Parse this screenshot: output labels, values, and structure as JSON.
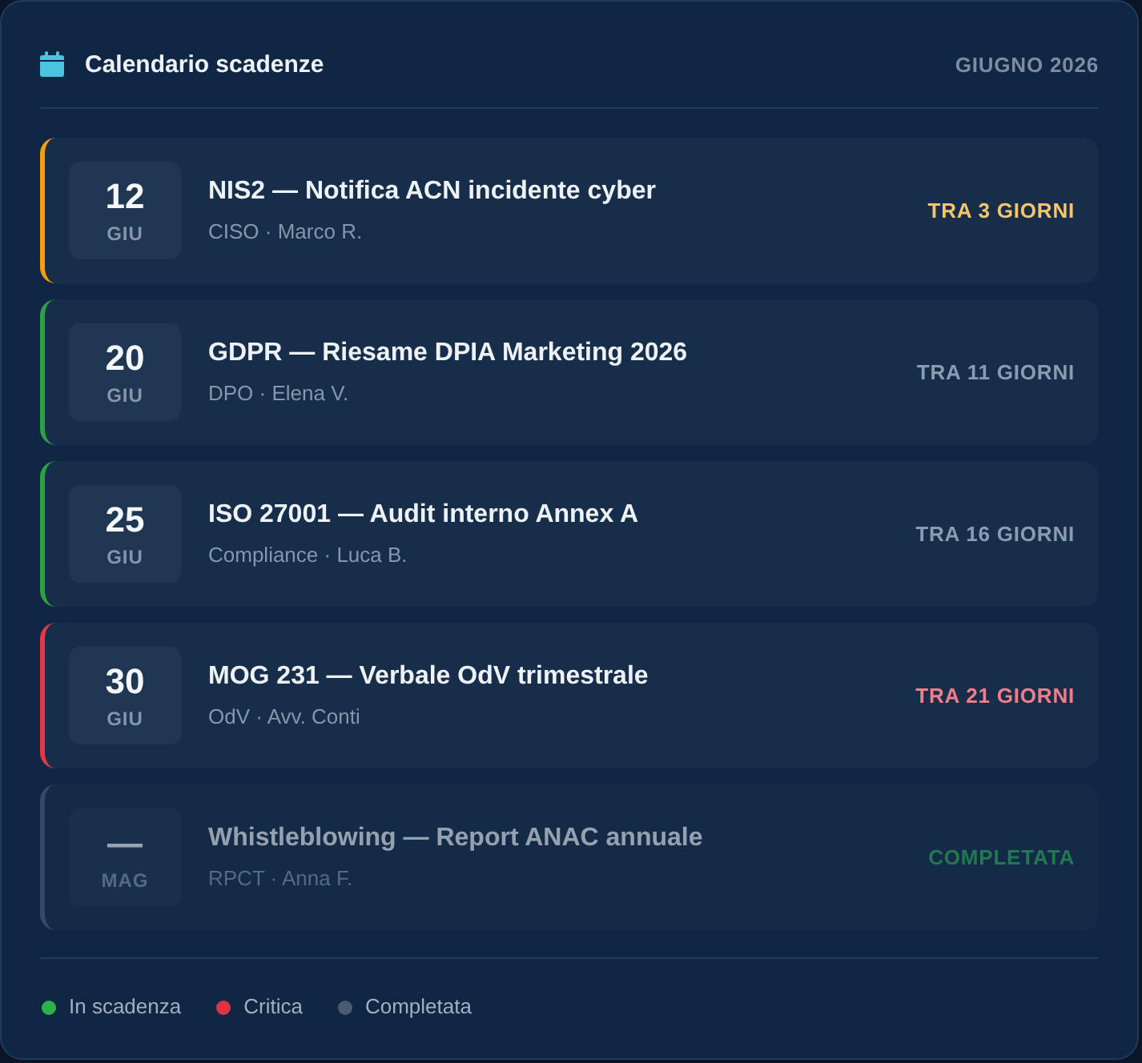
{
  "header": {
    "title": "Calendario scadenze",
    "period": "GIUGNO 2026"
  },
  "deadlines": [
    {
      "kind": "imminent",
      "day": "12",
      "month": "GIU",
      "title": "NIS2 — Notifica ACN incidente cyber",
      "owner": "CISO · Marco R.",
      "due": "TRA 3 GIORNI"
    },
    {
      "kind": "upcoming",
      "day": "20",
      "month": "GIU",
      "title": "GDPR — Riesame DPIA Marketing 2026",
      "owner": "DPO · Elena V.",
      "due": "TRA 11 GIORNI"
    },
    {
      "kind": "upcoming",
      "day": "25",
      "month": "GIU",
      "title": "ISO 27001 — Audit interno Annex A",
      "owner": "Compliance · Luca B.",
      "due": "TRA 16 GIORNI"
    },
    {
      "kind": "critical",
      "day": "30",
      "month": "GIU",
      "title": "MOG 231 — Verbale OdV trimestrale",
      "owner": "OdV · Avv. Conti",
      "due": "TRA 21 GIORNI"
    },
    {
      "kind": "completed",
      "day": "—",
      "month": "MAG",
      "title": "Whistleblowing — Report ANAC annuale",
      "owner": "RPCT · Anna F.",
      "due": "COMPLETATA"
    }
  ],
  "legend": [
    {
      "label": "In scadenza",
      "color": "#2db24a"
    },
    {
      "label": "Critica",
      "color": "#e03444"
    },
    {
      "label": "Completata",
      "color": "#4b5b70"
    }
  ]
}
